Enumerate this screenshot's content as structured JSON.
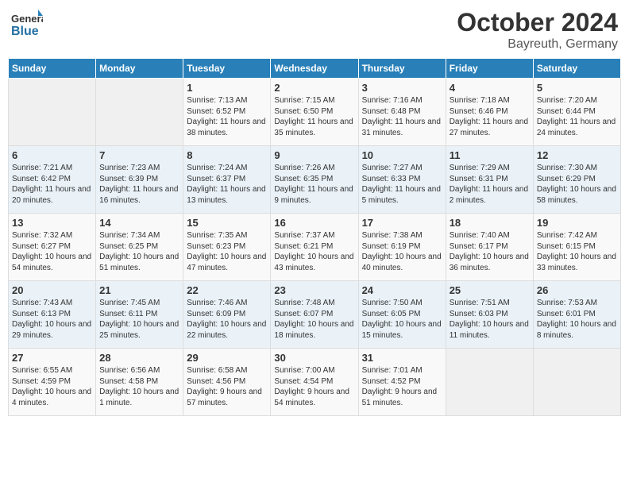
{
  "header": {
    "logo_general": "General",
    "logo_blue": "Blue",
    "month_year": "October 2024",
    "location": "Bayreuth, Germany"
  },
  "weekdays": [
    "Sunday",
    "Monday",
    "Tuesday",
    "Wednesday",
    "Thursday",
    "Friday",
    "Saturday"
  ],
  "weeks": [
    [
      {
        "day": "",
        "content": ""
      },
      {
        "day": "",
        "content": ""
      },
      {
        "day": "1",
        "content": "Sunrise: 7:13 AM\nSunset: 6:52 PM\nDaylight: 11 hours and 38 minutes."
      },
      {
        "day": "2",
        "content": "Sunrise: 7:15 AM\nSunset: 6:50 PM\nDaylight: 11 hours and 35 minutes."
      },
      {
        "day": "3",
        "content": "Sunrise: 7:16 AM\nSunset: 6:48 PM\nDaylight: 11 hours and 31 minutes."
      },
      {
        "day": "4",
        "content": "Sunrise: 7:18 AM\nSunset: 6:46 PM\nDaylight: 11 hours and 27 minutes."
      },
      {
        "day": "5",
        "content": "Sunrise: 7:20 AM\nSunset: 6:44 PM\nDaylight: 11 hours and 24 minutes."
      }
    ],
    [
      {
        "day": "6",
        "content": "Sunrise: 7:21 AM\nSunset: 6:42 PM\nDaylight: 11 hours and 20 minutes."
      },
      {
        "day": "7",
        "content": "Sunrise: 7:23 AM\nSunset: 6:39 PM\nDaylight: 11 hours and 16 minutes."
      },
      {
        "day": "8",
        "content": "Sunrise: 7:24 AM\nSunset: 6:37 PM\nDaylight: 11 hours and 13 minutes."
      },
      {
        "day": "9",
        "content": "Sunrise: 7:26 AM\nSunset: 6:35 PM\nDaylight: 11 hours and 9 minutes."
      },
      {
        "day": "10",
        "content": "Sunrise: 7:27 AM\nSunset: 6:33 PM\nDaylight: 11 hours and 5 minutes."
      },
      {
        "day": "11",
        "content": "Sunrise: 7:29 AM\nSunset: 6:31 PM\nDaylight: 11 hours and 2 minutes."
      },
      {
        "day": "12",
        "content": "Sunrise: 7:30 AM\nSunset: 6:29 PM\nDaylight: 10 hours and 58 minutes."
      }
    ],
    [
      {
        "day": "13",
        "content": "Sunrise: 7:32 AM\nSunset: 6:27 PM\nDaylight: 10 hours and 54 minutes."
      },
      {
        "day": "14",
        "content": "Sunrise: 7:34 AM\nSunset: 6:25 PM\nDaylight: 10 hours and 51 minutes."
      },
      {
        "day": "15",
        "content": "Sunrise: 7:35 AM\nSunset: 6:23 PM\nDaylight: 10 hours and 47 minutes."
      },
      {
        "day": "16",
        "content": "Sunrise: 7:37 AM\nSunset: 6:21 PM\nDaylight: 10 hours and 43 minutes."
      },
      {
        "day": "17",
        "content": "Sunrise: 7:38 AM\nSunset: 6:19 PM\nDaylight: 10 hours and 40 minutes."
      },
      {
        "day": "18",
        "content": "Sunrise: 7:40 AM\nSunset: 6:17 PM\nDaylight: 10 hours and 36 minutes."
      },
      {
        "day": "19",
        "content": "Sunrise: 7:42 AM\nSunset: 6:15 PM\nDaylight: 10 hours and 33 minutes."
      }
    ],
    [
      {
        "day": "20",
        "content": "Sunrise: 7:43 AM\nSunset: 6:13 PM\nDaylight: 10 hours and 29 minutes."
      },
      {
        "day": "21",
        "content": "Sunrise: 7:45 AM\nSunset: 6:11 PM\nDaylight: 10 hours and 25 minutes."
      },
      {
        "day": "22",
        "content": "Sunrise: 7:46 AM\nSunset: 6:09 PM\nDaylight: 10 hours and 22 minutes."
      },
      {
        "day": "23",
        "content": "Sunrise: 7:48 AM\nSunset: 6:07 PM\nDaylight: 10 hours and 18 minutes."
      },
      {
        "day": "24",
        "content": "Sunrise: 7:50 AM\nSunset: 6:05 PM\nDaylight: 10 hours and 15 minutes."
      },
      {
        "day": "25",
        "content": "Sunrise: 7:51 AM\nSunset: 6:03 PM\nDaylight: 10 hours and 11 minutes."
      },
      {
        "day": "26",
        "content": "Sunrise: 7:53 AM\nSunset: 6:01 PM\nDaylight: 10 hours and 8 minutes."
      }
    ],
    [
      {
        "day": "27",
        "content": "Sunrise: 6:55 AM\nSunset: 4:59 PM\nDaylight: 10 hours and 4 minutes."
      },
      {
        "day": "28",
        "content": "Sunrise: 6:56 AM\nSunset: 4:58 PM\nDaylight: 10 hours and 1 minute."
      },
      {
        "day": "29",
        "content": "Sunrise: 6:58 AM\nSunset: 4:56 PM\nDaylight: 9 hours and 57 minutes."
      },
      {
        "day": "30",
        "content": "Sunrise: 7:00 AM\nSunset: 4:54 PM\nDaylight: 9 hours and 54 minutes."
      },
      {
        "day": "31",
        "content": "Sunrise: 7:01 AM\nSunset: 4:52 PM\nDaylight: 9 hours and 51 minutes."
      },
      {
        "day": "",
        "content": ""
      },
      {
        "day": "",
        "content": ""
      }
    ]
  ]
}
